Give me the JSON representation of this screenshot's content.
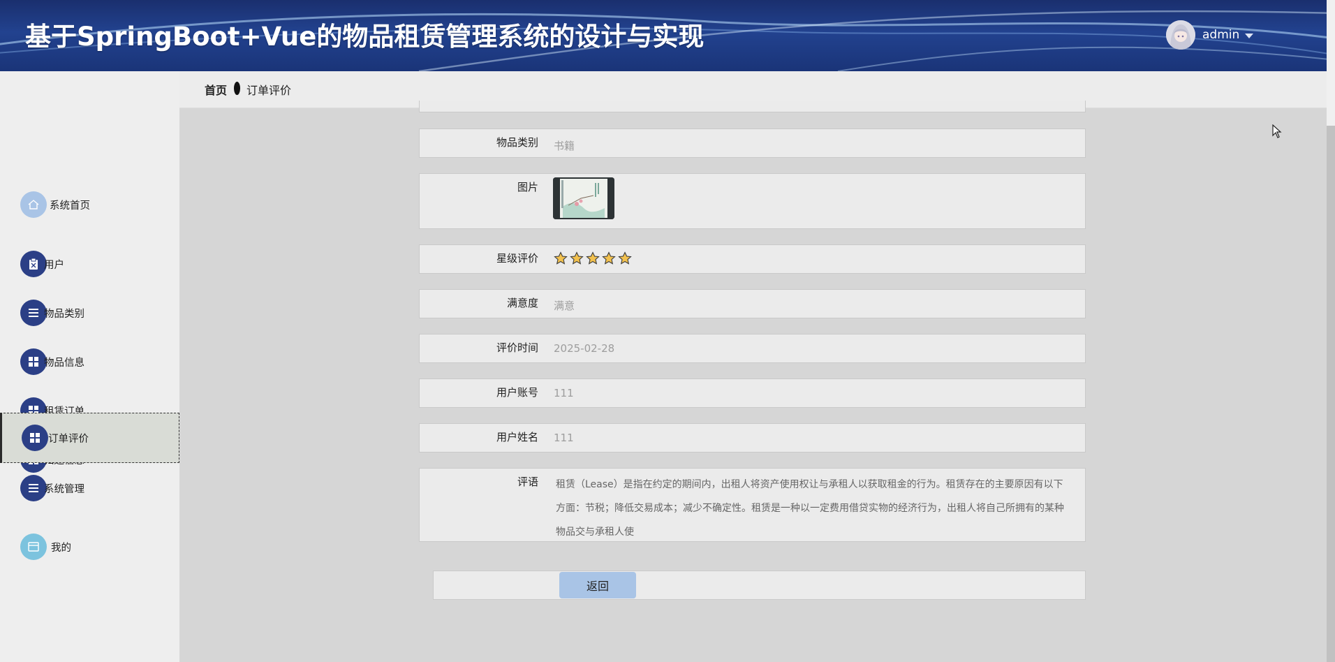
{
  "header": {
    "title": "基于SpringBoot+Vue的物品租赁管理系统的设计与实现",
    "username": "admin"
  },
  "breadcrumb": {
    "home": "首页",
    "current": "订单评价"
  },
  "sidebar": {
    "items": [
      {
        "label": "系统首页",
        "icon": "home-icon"
      },
      {
        "label": "用户",
        "icon": "user-clipboard-icon"
      },
      {
        "label": "物品类别",
        "icon": "list-icon"
      },
      {
        "label": "物品信息",
        "icon": "grid-icon"
      },
      {
        "label": "租赁订单",
        "icon": "grid-icon"
      },
      {
        "label": "归还信息",
        "icon": "grid-icon"
      },
      {
        "label": "订单评价",
        "icon": "grid-icon",
        "active": true
      },
      {
        "label": "系统管理",
        "icon": "list-icon"
      },
      {
        "label": "我的",
        "icon": "window-icon"
      }
    ]
  },
  "form": {
    "category_label": "物品类别",
    "category_value": "书籍",
    "image_label": "图片",
    "rating_label": "星级评价",
    "rating_value": 5,
    "satisfaction_label": "满意度",
    "satisfaction_value": "满意",
    "time_label": "评价时间",
    "time_value": "2025-02-28",
    "account_label": "用户账号",
    "account_value": "111",
    "name_label": "用户姓名",
    "name_value": "111",
    "comment_label": "评语",
    "comment_value": "租赁（Lease）是指在约定的期间内，出租人将资产使用权让与承租人以获取租金的行为。租赁存在的主要原因有以下方面：节税；降低交易成本；减少不确定性。租赁是一种以一定费用借贷实物的经济行为，出租人将自己所拥有的某种物品交与承租人使"
  },
  "actions": {
    "back_label": "返回"
  },
  "colors": {
    "header_bg": "#22428f",
    "icon_bg": "#2b3f86",
    "button_bg": "#a9c4e6",
    "star": "#f2c14e"
  }
}
